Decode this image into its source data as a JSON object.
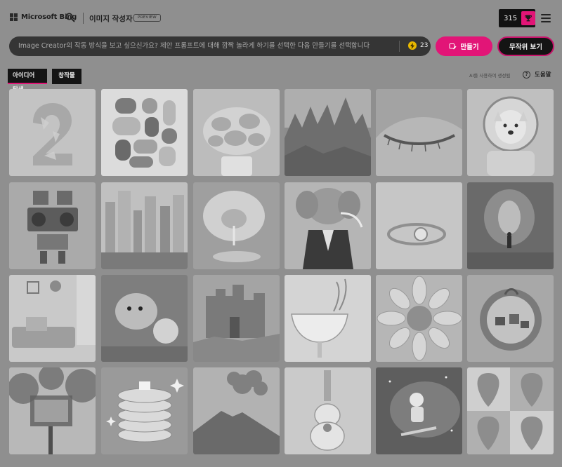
{
  "header": {
    "logo_text": "Microsoft Bing",
    "app_title": "이미지 작성자",
    "preview_badge": "PREVIEW",
    "coins": "315",
    "icons": {
      "search": "search-icon",
      "trophy": "trophy-icon",
      "menu": "hamburger-menu-icon",
      "logo": "microsoft-logo-icon"
    }
  },
  "prompt": {
    "placeholder": "Image Creator의 작동 방식을 보고 싶으신가요? 제안 프롬프트에 대해 깜짝 놀라게 하기를 선택한 다음 만들기를 선택합니다",
    "boosts": "23",
    "create_label": "만들기",
    "surprise_label": "무작위 보기",
    "icons": {
      "boost": "lightning-bolt-icon",
      "create": "brush-icon"
    }
  },
  "tabs": [
    {
      "label": "아이디어 탐색",
      "active": true
    },
    {
      "label": "창작물",
      "active": false
    }
  ],
  "ai_note": "AI를 사용하여 생성됨",
  "help_label": "도움말",
  "colors": {
    "accent": "#e21577",
    "overlay_gray": "#8f8f8f",
    "dark": "#141414"
  },
  "gallery": [
    {
      "subject": "number-2"
    },
    {
      "subject": "abstract-blobs"
    },
    {
      "subject": "flower-bouquet"
    },
    {
      "subject": "fantasy-castle-landscape"
    },
    {
      "subject": "closed-eye"
    },
    {
      "subject": "dog-astronaut"
    },
    {
      "subject": "robot-boombox"
    },
    {
      "subject": "futuristic-city"
    },
    {
      "subject": "lemon-drip"
    },
    {
      "subject": "elephant-in-tuxedo"
    },
    {
      "subject": "ring"
    },
    {
      "subject": "figure-in-light"
    },
    {
      "subject": "cozy-room"
    },
    {
      "subject": "hamster-crystal-ball"
    },
    {
      "subject": "castle-ruins"
    },
    {
      "subject": "cocktail-glass"
    },
    {
      "subject": "dahlia-flower"
    },
    {
      "subject": "miniature-village"
    },
    {
      "subject": "treehouse"
    },
    {
      "subject": "pancake-stack"
    },
    {
      "subject": "volcano"
    },
    {
      "subject": "flower-guitar"
    },
    {
      "subject": "space-skateboarder"
    },
    {
      "subject": "strawberry-pattern"
    }
  ]
}
